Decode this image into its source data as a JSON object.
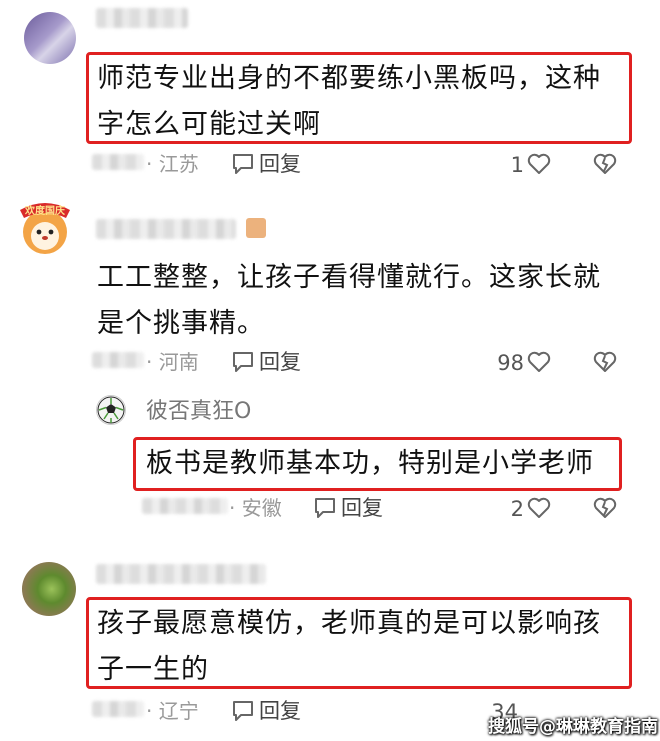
{
  "comments": [
    {
      "text": "师范专业出身的不都要练小黑板吗，这种字怎么可能过关啊",
      "location": "· 江苏",
      "reply_label": "回复",
      "likes": "1"
    },
    {
      "text": "工工整整，让孩子看得懂就行。这家长就是个挑事精。",
      "location": "· 河南",
      "reply_label": "回复",
      "likes": "98"
    },
    {
      "username": "彼否真狂O",
      "text": "板书是教师基本功，特别是小学老师",
      "location": "· 安徽",
      "reply_label": "回复",
      "likes": "2"
    },
    {
      "text": "孩子最愿意模仿，老师真的是可以影响孩子一生的",
      "location": "· 辽宁",
      "reply_label": "回复",
      "likes": "34"
    }
  ],
  "badge_text": "欢度国庆",
  "watermark": "搜狐号@琳琳教育指南",
  "colors": {
    "highlight_border": "#e02020",
    "meta_text": "#999999"
  }
}
